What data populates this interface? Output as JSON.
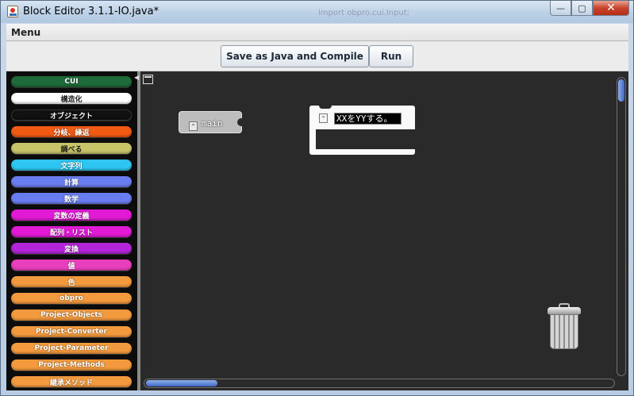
{
  "window": {
    "title": "Block Editor 3.1.1-IO.java*",
    "ghost_text": "import obpro.cui.Input;",
    "controls": {
      "minimize": "—",
      "maximize": "▢",
      "close": "✕"
    }
  },
  "menu": {
    "label": "Menu"
  },
  "toolbar": {
    "save_label": "Save as Java and Compile",
    "run_label": "Run"
  },
  "palette": {
    "drawers": [
      {
        "label": "CUI",
        "color": "#1f6b3a"
      },
      {
        "label": "構造化",
        "color": "#ffffff"
      },
      {
        "label": "オブジェクト",
        "color": "#111111"
      },
      {
        "label": "分岐、繰返",
        "color": "#f05a13"
      },
      {
        "label": "調べる",
        "color": "#c7c46a"
      },
      {
        "label": "文字列",
        "color": "#2ec6f0"
      },
      {
        "label": "計算",
        "color": "#6a7df0"
      },
      {
        "label": "数学",
        "color": "#6a7df0"
      },
      {
        "label": "変数の定義",
        "color": "#e21ad6"
      },
      {
        "label": "配列・リスト",
        "color": "#e21ad6"
      },
      {
        "label": "変換",
        "color": "#b424d8"
      },
      {
        "label": "値",
        "color": "#e83fbd"
      },
      {
        "label": "色",
        "color": "#f39a3e"
      },
      {
        "label": "obpro",
        "color": "#f39a3e"
      },
      {
        "label": "Project-Objects",
        "color": "#f39a3e"
      },
      {
        "label": "Project-Converter",
        "color": "#f39a3e"
      },
      {
        "label": "Project-Parameter",
        "color": "#f39a3e"
      },
      {
        "label": "Project-Methods",
        "color": "#f39a3e"
      },
      {
        "label": "継承メソッド",
        "color": "#f39a3e"
      }
    ]
  },
  "workspace": {
    "blocks": [
      {
        "type": "main",
        "label": "main",
        "collapse": "-"
      },
      {
        "type": "statement",
        "text_value": "XXをYYする。",
        "collapse": "-"
      }
    ]
  },
  "colors": {
    "workspace_bg": "#2a2a2a",
    "palette_bg": "#0c0c0c",
    "scroll_thumb": "#3d67c5"
  }
}
